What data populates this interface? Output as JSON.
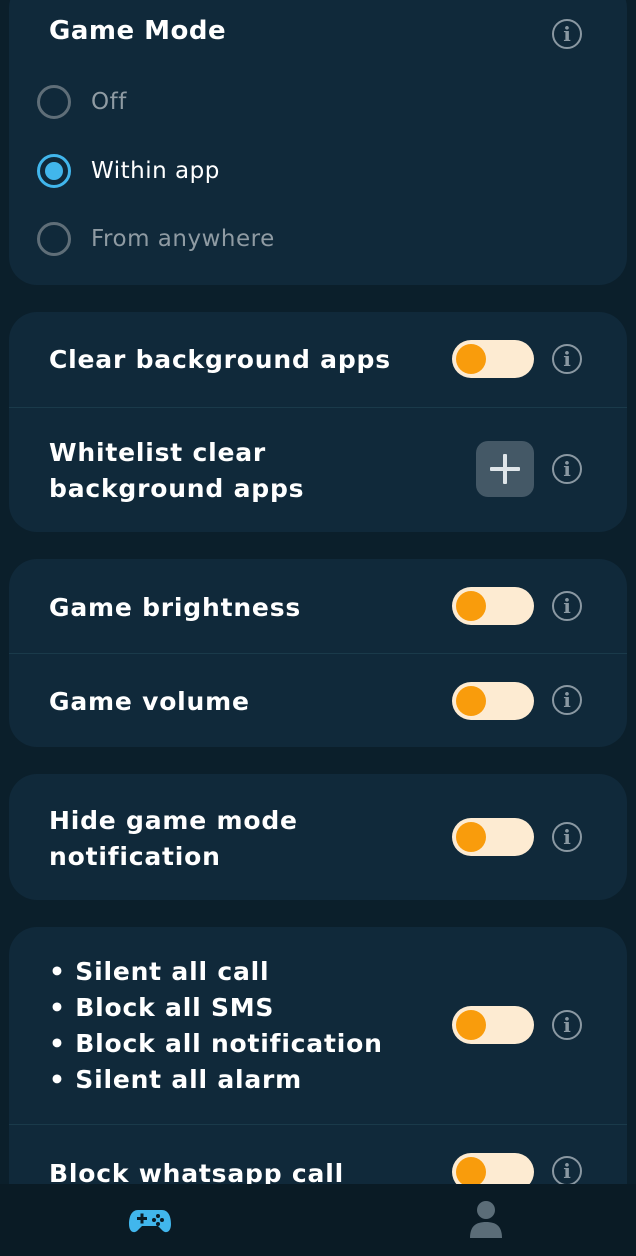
{
  "game_mode": {
    "title": "Game Mode",
    "options": [
      {
        "label": "Off",
        "selected": false
      },
      {
        "label": "Within app",
        "selected": true
      },
      {
        "label": "From anywhere",
        "selected": false
      }
    ]
  },
  "background": {
    "clear_label": "Clear background apps",
    "clear_on": false,
    "whitelist_label_line1": "Whitelist clear",
    "whitelist_label_line2": "background apps"
  },
  "game_settings": {
    "brightness_label": "Game brightness",
    "brightness_on": false,
    "volume_label": "Game volume",
    "volume_on": false
  },
  "notification": {
    "hide_label_line1": "Hide game mode",
    "hide_label_line2": "notification",
    "hide_on": false
  },
  "blocking": {
    "bullets": [
      "• Silent all call",
      "• Block all SMS",
      "• Block all notification",
      "• Silent all alarm"
    ],
    "bullets_on": false,
    "whatsapp_label": "Block whatsapp call",
    "whatsapp_on": false
  },
  "icons": {
    "info": "info-icon",
    "add": "plus-icon",
    "nav_game": "gamepad-icon",
    "nav_profile": "profile-icon"
  },
  "colors": {
    "background": "#0b1f2b",
    "card": "#10293a",
    "toggle_track": "#fdebd2",
    "toggle_knob": "#f99c0c",
    "radio_active": "#41b6ec",
    "nav_active": "#41b6ec",
    "nav_inactive": "#5b6d78"
  }
}
